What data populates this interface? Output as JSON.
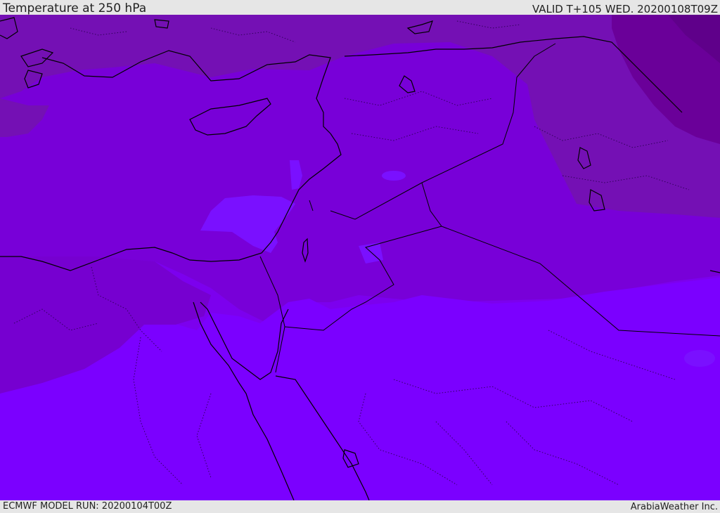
{
  "header": {
    "title": "Temperature at 250 hPa",
    "valid_time": "VALID T+105 WED. 20200108T09Z"
  },
  "footer": {
    "model_run": "ECMWF MODEL RUN: 20200104T00Z",
    "credit": "ArabiaWeather Inc."
  },
  "map": {
    "variable": "temperature",
    "level": "250 hPa",
    "palette": {
      "coldest": "#6a0099",
      "cold": "#7410b4",
      "mid": "#7800d8",
      "warm": "#7c00ee",
      "warmest": "#7b00ff",
      "patch": "#7a10ff",
      "coastline": "#000000",
      "border": "#2a0050"
    }
  }
}
